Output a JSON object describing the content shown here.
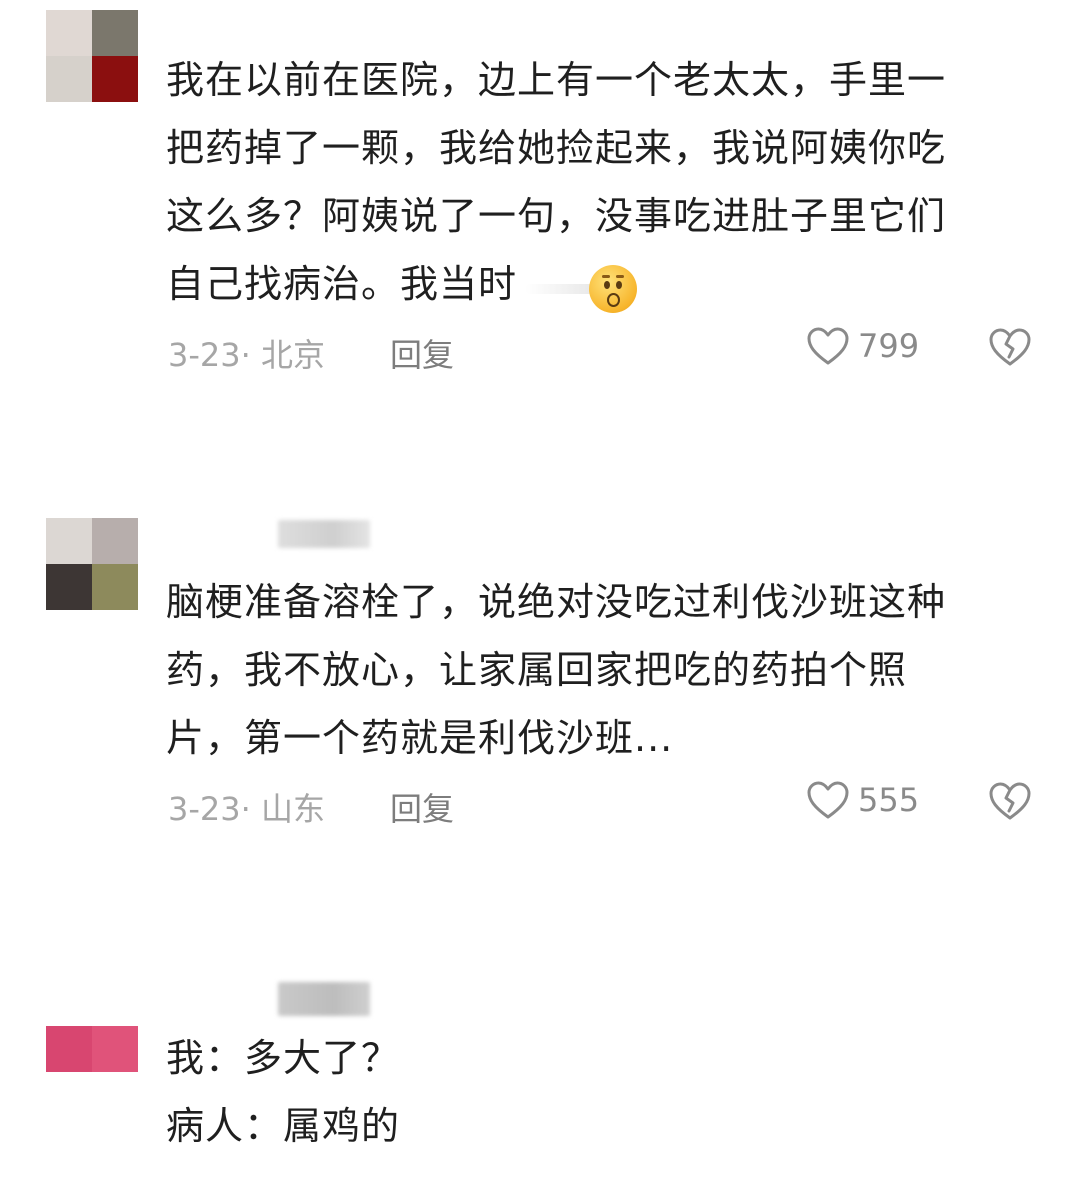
{
  "comments": [
    {
      "avatar_colors": [
        "#e0d8d3",
        "#7b776c",
        "#d6d1cb",
        "#8b0f0f"
      ],
      "lines": [
        "我在以前在医院，边上有一个老太太，手里一",
        "把药掉了一颗，我给她捡起来，我说阿姨你吃",
        "这么多？阿姨说了一句，没事吃进肚子里它们",
        "自己找病治。我当时"
      ],
      "emoji": "hushed-face-emoji",
      "date": "3-23· 北京",
      "reply_label": "回复",
      "like_count": "799"
    },
    {
      "avatar_colors": [
        "#dcd7d3",
        "#b7aeac",
        "#3d3634",
        "#8d8a5c"
      ],
      "lines": [
        "脑梗准备溶栓了，说绝对没吃过利伐沙班这种",
        "药，我不放心，让家属回家把吃的药拍个照",
        "片，第一个药就是利伐沙班..."
      ],
      "date": "3-23· 山东",
      "reply_label": "回复",
      "like_count": "555"
    },
    {
      "avatar_colors": [
        "#d84670",
        "#e0537a",
        "#ffffff",
        "#ffffff"
      ],
      "lines": [
        "我：多大了？",
        "病人：属鸡的"
      ]
    }
  ]
}
